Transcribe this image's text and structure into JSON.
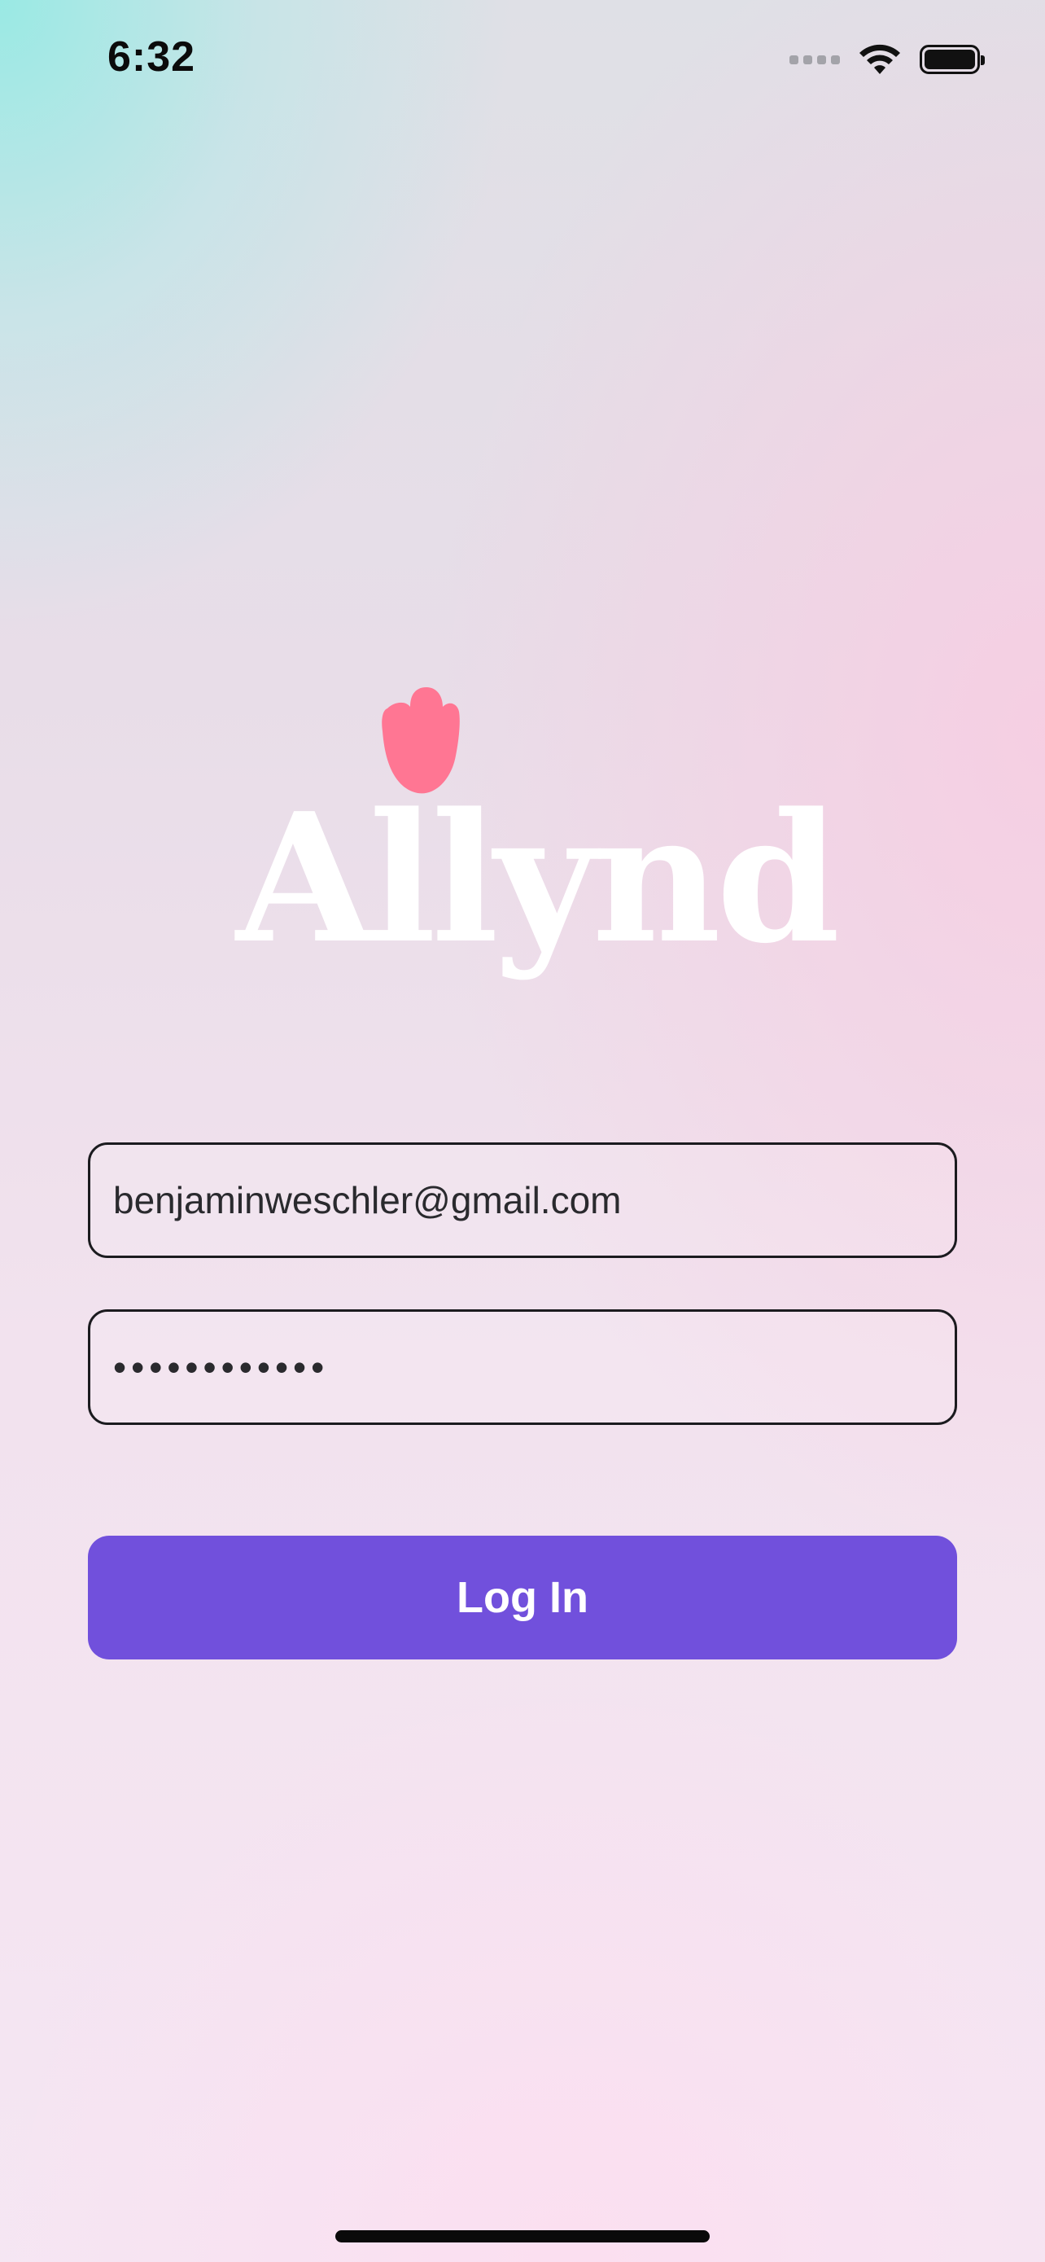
{
  "status_bar": {
    "time": "6:32",
    "icons": [
      "cellular-signal-icon",
      "wifi-icon",
      "battery-icon"
    ]
  },
  "logo": {
    "wordmark": "Allynd",
    "icon": "tulip-icon",
    "icon_color": "#ff7693",
    "wordmark_color": "#ffffff"
  },
  "form": {
    "email_value": "benjaminweschler@gmail.com",
    "password_value": "••••••••••••"
  },
  "login_button": {
    "label": "Log In",
    "color": "#7150dc"
  },
  "colors": {
    "field_border": "#1b1b1f",
    "background_top_left": "#96eae4",
    "background_right": "#f7cde2"
  }
}
